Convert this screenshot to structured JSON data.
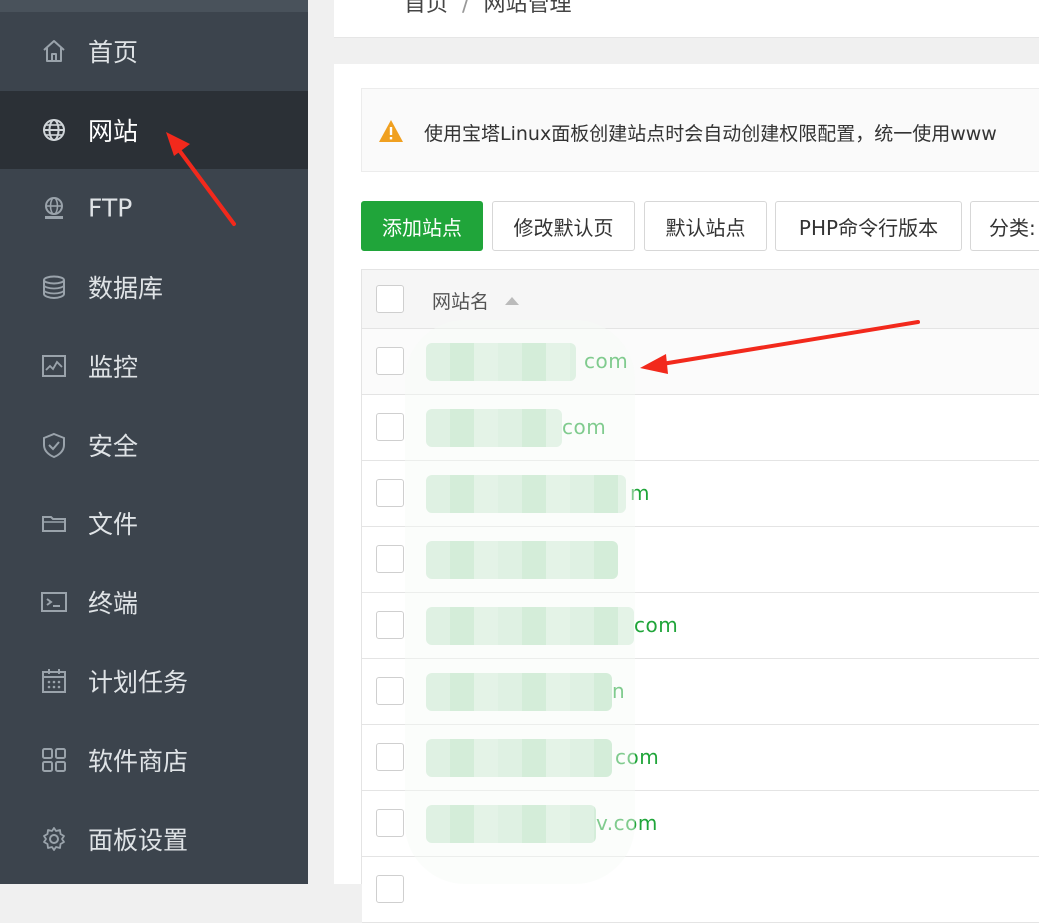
{
  "sidebar": {
    "items": [
      {
        "label": "首页",
        "icon": "home-icon"
      },
      {
        "label": "网站",
        "icon": "globe-icon",
        "active": true
      },
      {
        "label": "FTP",
        "icon": "ftp-icon"
      },
      {
        "label": "数据库",
        "icon": "database-icon"
      },
      {
        "label": "监控",
        "icon": "monitor-icon"
      },
      {
        "label": "安全",
        "icon": "shield-icon"
      },
      {
        "label": "文件",
        "icon": "folder-icon"
      },
      {
        "label": "终端",
        "icon": "terminal-icon"
      },
      {
        "label": "计划任务",
        "icon": "calendar-icon"
      },
      {
        "label": "软件商店",
        "icon": "apps-icon"
      },
      {
        "label": "面板设置",
        "icon": "gear-icon"
      }
    ]
  },
  "breadcrumb": {
    "home": "首页",
    "current": "网站管理"
  },
  "notice": {
    "text": "使用宝塔Linux面板创建站点时会自动创建权限配置，统一使用www"
  },
  "toolbar": {
    "add_site": "添加站点",
    "modify_default_page": "修改默认页",
    "default_site": "默认站点",
    "php_cli_version": "PHP命令行版本",
    "category": "分类:"
  },
  "table": {
    "header": {
      "site_name": "网站名"
    },
    "rows": [
      {
        "name_suffix": "com"
      },
      {
        "name_suffix": "com"
      },
      {
        "name_suffix": "m"
      },
      {
        "name_suffix": ""
      },
      {
        "name_suffix": "com"
      },
      {
        "name_suffix": "n"
      },
      {
        "name_suffix": "com"
      },
      {
        "name_suffix": "v.com"
      }
    ]
  },
  "colors": {
    "sidebar_bg": "#3c444d",
    "sidebar_active_bg": "#2b3036",
    "accent_green": "#20a53a",
    "annotation_red": "#f2291c",
    "warning_orange": "#f0a020"
  }
}
